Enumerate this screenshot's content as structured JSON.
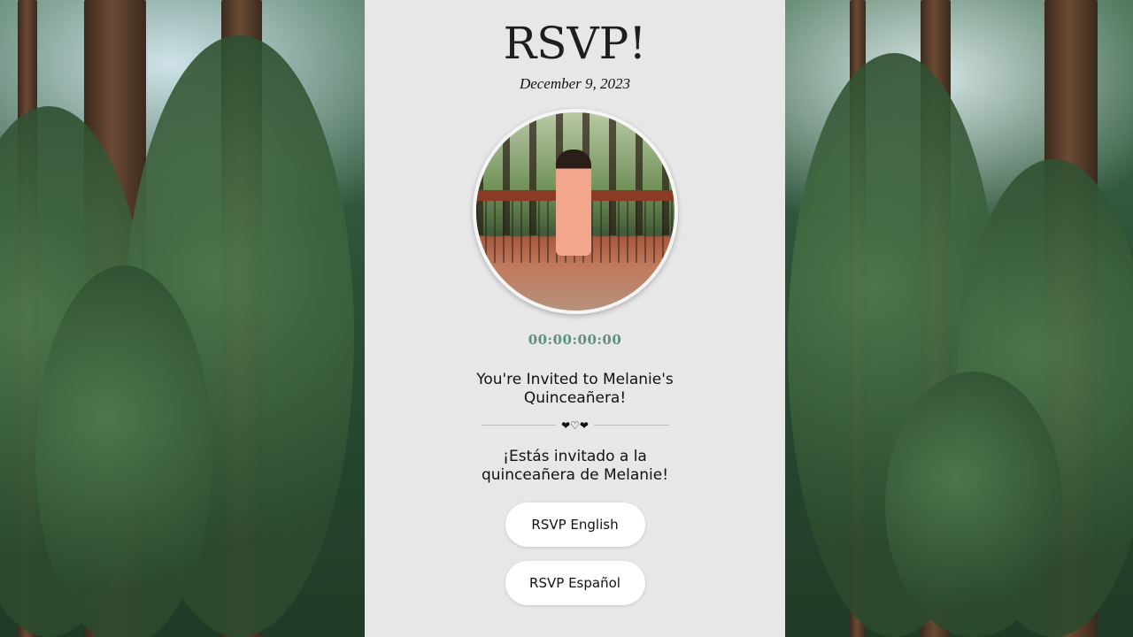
{
  "card": {
    "title": "RSVP!",
    "date": "December 9, 2023",
    "countdown": "00:00:00:00",
    "invite_en": "You're Invited to Melanie's Quinceañera!",
    "hearts": "❤♡❤",
    "invite_es": "¡Estás invitado a la quinceañera de Melanie!",
    "button_en": "RSVP English",
    "button_es": "RSVP Español"
  },
  "colors": {
    "card_background": "#e7e7e7",
    "countdown": "#5f8f7d",
    "button_background": "#ffffff"
  }
}
